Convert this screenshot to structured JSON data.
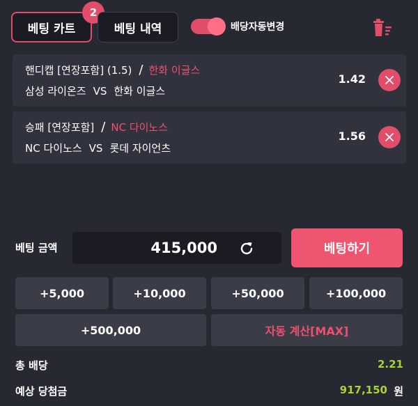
{
  "tabs": {
    "cart_label": "베팅 카트",
    "cart_count": "2",
    "history_label": "베팅 내역"
  },
  "toggle": {
    "label": "배당자동변경",
    "on": true
  },
  "bets": [
    {
      "market": "핸디캡 [연장포함] (1.5)",
      "separator": "/",
      "pick": "한화 이글스",
      "home": "삼성 라이온즈",
      "vs": "VS",
      "away": "한화 이글스",
      "odds": "1.42"
    },
    {
      "market": "승패 [연장포함]",
      "separator": "/",
      "pick": "NC 다이노스",
      "home": "NC 다이노스",
      "vs": "VS",
      "away": "롯데 자이언츠",
      "odds": "1.56"
    }
  ],
  "amount": {
    "label": "베팅 금액",
    "value": "415,000"
  },
  "bet_button": "베팅하기",
  "quick_amounts": [
    "+5,000",
    "+10,000",
    "+50,000",
    "+100,000",
    "+500,000"
  ],
  "auto_max": "자동 계산[MAX]",
  "totals": {
    "odds_label": "총 배당",
    "odds_value": "2.21",
    "win_label": "예상 당첨금",
    "win_value": "917,150",
    "currency": "원"
  },
  "colors": {
    "accent": "#e24d6a",
    "positive": "#a7d430",
    "background": "#262832"
  },
  "icons": {
    "trash": "trash-icon",
    "remove": "close-icon",
    "refresh": "refresh-icon"
  }
}
